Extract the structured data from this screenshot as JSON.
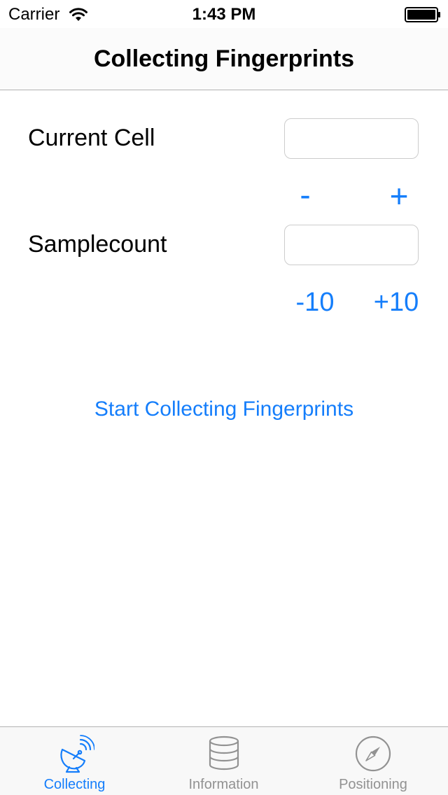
{
  "status_bar": {
    "carrier": "Carrier",
    "time": "1:43 PM"
  },
  "nav": {
    "title": "Collecting Fingerprints"
  },
  "form": {
    "current_cell_label": "Current Cell",
    "current_cell_value": "",
    "cell_decrement_label": "-",
    "cell_increment_label": "+",
    "samplecount_label": "Samplecount",
    "samplecount_value": "",
    "sample_decrement_label": "-10",
    "sample_increment_label": "+10",
    "start_button_label": "Start Collecting Fingerprints"
  },
  "tab_bar": {
    "items": [
      {
        "label": "Collecting",
        "icon": "satellite-dish-icon",
        "active": true
      },
      {
        "label": "Information",
        "icon": "database-icon",
        "active": false
      },
      {
        "label": "Positioning",
        "icon": "compass-icon",
        "active": false
      }
    ]
  },
  "colors": {
    "accent": "#157efb",
    "inactive": "#929292",
    "separator": "#b2b2b2"
  }
}
